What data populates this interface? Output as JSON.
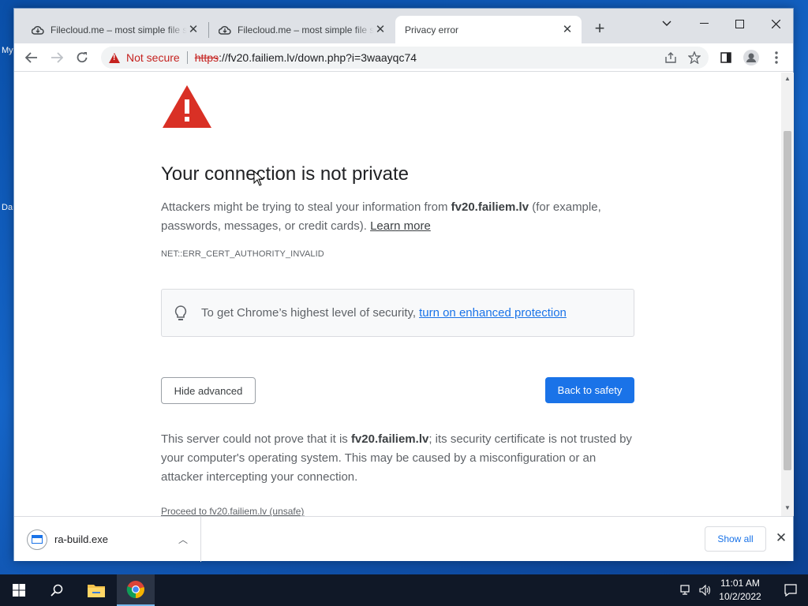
{
  "desktop": {
    "frag1": "My",
    "frag2": "Da"
  },
  "browser": {
    "tabs": [
      {
        "title": "Filecloud.me – most simple file sharing",
        "icon": "cloud-icon",
        "active": false
      },
      {
        "title": "Filecloud.me – most simple file sharing",
        "icon": "cloud-icon",
        "active": false
      },
      {
        "title": "Privacy error",
        "icon": "",
        "active": true
      }
    ],
    "address": {
      "security_label": "Not secure",
      "scheme": "https",
      "rest": "://fv20.failiem.lv/down.php?i=3waayqc74"
    }
  },
  "page": {
    "title": "Your connection is not private",
    "intro_before": "Attackers might be trying to steal your information from ",
    "intro_host": "fv20.failiem.lv",
    "intro_after": " (for example, passwords, messages, or credit cards). ",
    "learn_more": "Learn more",
    "error_code": "NET::ERR_CERT_AUTHORITY_INVALID",
    "tip_text": "To get Chrome’s highest level of security,",
    "tip_link": "turn on enhanced protection",
    "hide_advanced": "Hide advanced",
    "back_to_safety": "Back to safety",
    "details_before": "This server could not prove that it is ",
    "details_host": "fv20.failiem.lv",
    "details_after": "; its security certificate is not trusted by your computer's operating system. This may be caused by a misconfiguration or an attacker intercepting your connection.",
    "proceed_link": "Proceed to fv20.failiem.lv (unsafe)"
  },
  "downloads": {
    "file_name": "ra-build.exe",
    "show_all": "Show all"
  },
  "taskbar": {
    "time": "11:01 AM",
    "date": "10/2/2022"
  },
  "colors": {
    "danger": "#c5221f",
    "primary": "#1a73e8"
  }
}
